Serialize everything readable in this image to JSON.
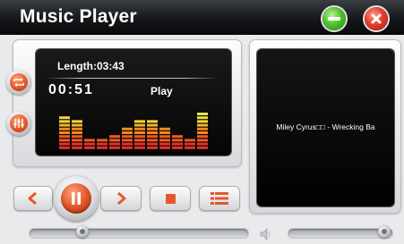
{
  "window": {
    "title": "Music Player",
    "minimize_icon": "minus-icon",
    "close_icon": "x-icon",
    "colors": {
      "titlebar": "#15171a",
      "accent": "#e4582b",
      "minimize": "#4fc12a",
      "close": "#e63d2b"
    }
  },
  "display": {
    "length": "Length:03:43",
    "elapsed": "00:51",
    "state": "Play",
    "equalizer_levels": [
      0.7,
      0.6,
      0.25,
      0.25,
      0.3,
      0.45,
      0.65,
      0.65,
      0.45,
      0.3,
      0.25,
      0.8
    ]
  },
  "side_buttons": [
    {
      "name": "repeat-button",
      "icon": "repeat-icon"
    },
    {
      "name": "equalizer-settings-button",
      "icon": "equalizer-icon"
    }
  ],
  "now_playing": {
    "text": "Miley Cyrus□□ - Wrecking Ba"
  },
  "controls": {
    "prev_icon": "chevron-left-icon",
    "pause_icon": "pause-icon",
    "next_icon": "chevron-right-icon",
    "stop_icon": "stop-icon",
    "playlist_icon": "list-icon"
  },
  "progress": {
    "fraction": 0.24
  },
  "volume": {
    "icon": "speaker-icon",
    "fraction": 0.92
  }
}
